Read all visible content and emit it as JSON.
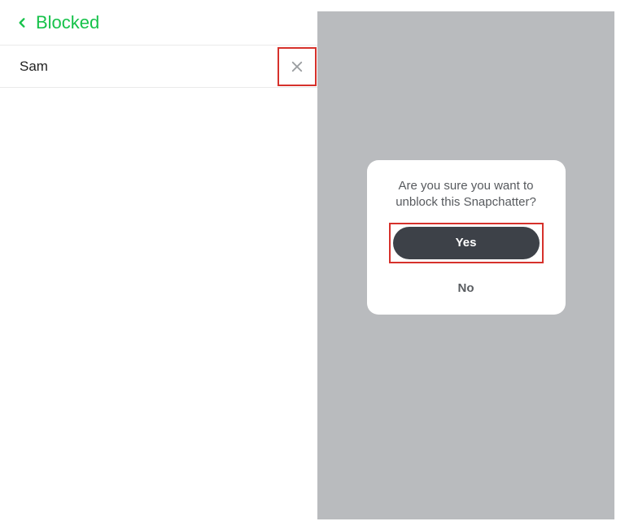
{
  "header": {
    "title": "Blocked"
  },
  "blockedList": {
    "items": [
      {
        "name": "Sam"
      }
    ]
  },
  "dialog": {
    "message_line1": "Are you sure you want to",
    "message_line2": "unblock this Snapchatter?",
    "yes_label": "Yes",
    "no_label": "No"
  },
  "colors": {
    "accent_green": "#16c24a",
    "highlight_red": "#d6312b",
    "dialog_button": "#3d4148",
    "right_bg": "#b9bbbe"
  }
}
